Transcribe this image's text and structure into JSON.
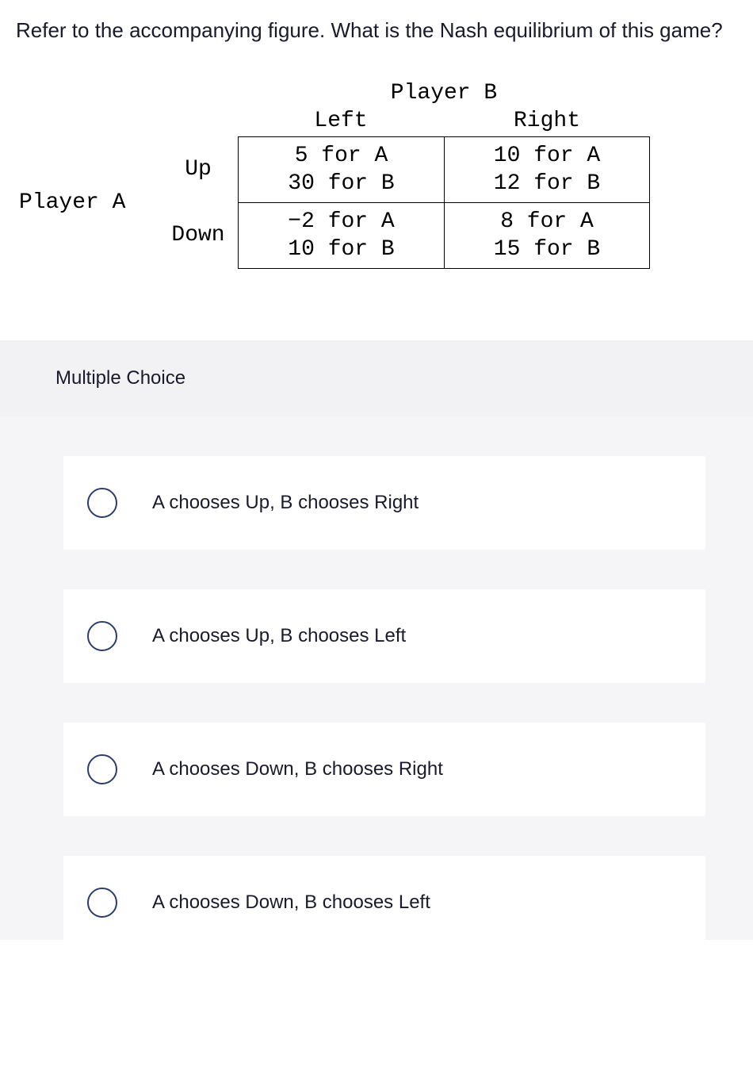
{
  "question": "Refer to the accompanying figure. What is the Nash equilibrium of this game?",
  "matrix": {
    "playerB_label": "Player B",
    "playerA_label": "Player A",
    "col_left": "Left",
    "col_right": "Right",
    "row_up": "Up",
    "row_down": "Down",
    "cells": {
      "up_left_a": "5 for A",
      "up_left_b": "30 for B",
      "up_right_a": "10 for A",
      "up_right_b": "12 for B",
      "down_left_a": "−2 for A",
      "down_left_b": "10 for B",
      "down_right_a": "8 for A",
      "down_right_b": "15 for B"
    }
  },
  "mc_heading": "Multiple Choice",
  "options": [
    {
      "label": "A chooses Up, B chooses Right"
    },
    {
      "label": "A chooses Up, B chooses Left"
    },
    {
      "label": "A chooses Down, B chooses Right"
    },
    {
      "label": "A chooses Down, B chooses Left"
    }
  ],
  "chart_data": {
    "type": "table",
    "title": "2x2 Payoff Matrix",
    "row_player": "Player A",
    "col_player": "Player B",
    "rows": [
      "Up",
      "Down"
    ],
    "cols": [
      "Left",
      "Right"
    ],
    "payoffs": [
      [
        {
          "A": 5,
          "B": 30
        },
        {
          "A": 10,
          "B": 12
        }
      ],
      [
        {
          "A": -2,
          "B": 10
        },
        {
          "A": 8,
          "B": 15
        }
      ]
    ]
  }
}
